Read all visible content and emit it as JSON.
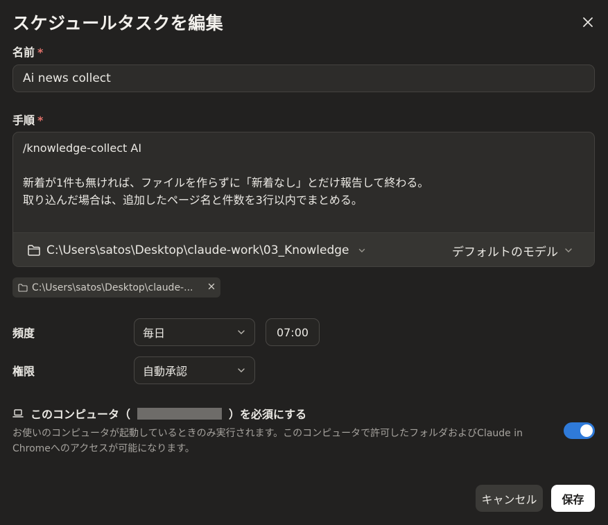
{
  "dialog": {
    "title": "スケジュールタスクを編集"
  },
  "name_field": {
    "label": "名前",
    "required_mark": "*",
    "value": "Ai news collect"
  },
  "steps_field": {
    "label": "手順",
    "required_mark": "*",
    "value": "/knowledge-collect AI\n\n新着が1件も無ければ、ファイルを作らずに「新着なし」とだけ報告して終わる。\n取り込んだ場合は、追加したページ名と件数を3行以内でまとめる。",
    "folder_path": "C:\\Users\\satos\\Desktop\\claude-work\\03_Knowledge",
    "model": "デフォルトのモデル"
  },
  "folder_chip": {
    "text": "C:\\Users\\satos\\Desktop\\claude-..."
  },
  "frequency": {
    "label": "頻度",
    "value": "毎日",
    "time": "07:00"
  },
  "permission": {
    "label": "権限",
    "value": "自動承認"
  },
  "computer_requirement": {
    "title_prefix": "このコンピュータ（",
    "title_suffix": "）を必須にする",
    "description": "お使いのコンピュータが起動しているときのみ実行されます。このコンピュータで許可したフォルダおよびClaude in Chromeへのアクセスが可能になります。",
    "toggle_on": true
  },
  "actions": {
    "cancel_label": "キャンセル",
    "save_label": "保存"
  },
  "colors": {
    "background": "#222120",
    "accent_toggle": "#2f7ad9",
    "required": "#e2726b"
  }
}
